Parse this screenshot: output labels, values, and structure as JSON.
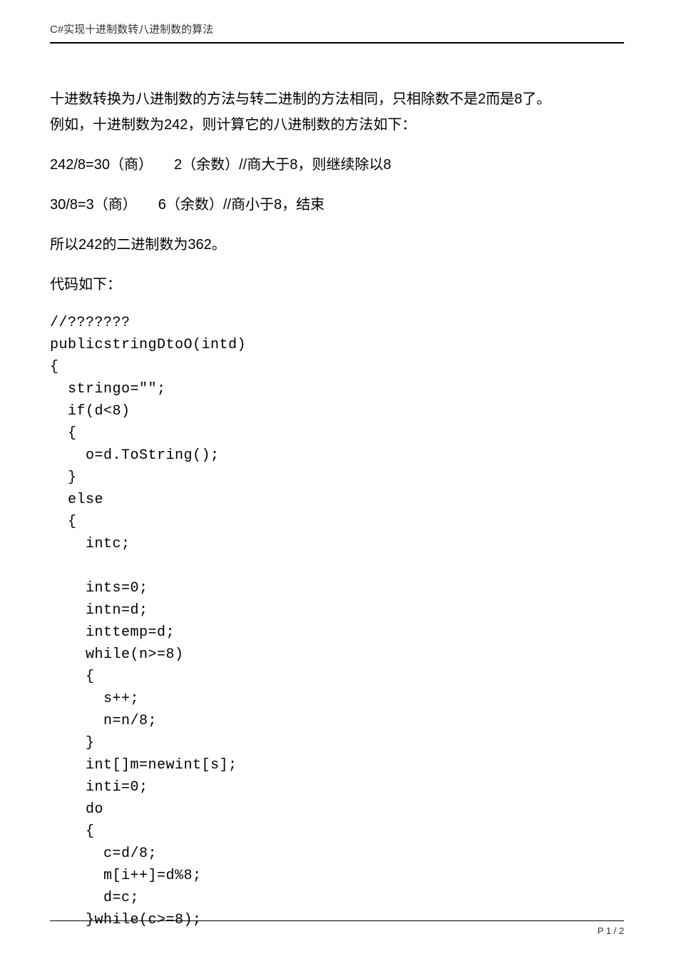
{
  "header": {
    "title": "C#实现十进制数转八进制数的算法"
  },
  "body": {
    "p1a": "十进数转换为八进制数的方法与转二进制的方法相同，只相除数不是2而是8了。",
    "p1b": "例如，十进制数为242，则计算它的八进制数的方法如下：",
    "p2": "242/8=30（商）　　2（余数）//商大于8，则继续除以8",
    "p3": "30/8=3（商）　　6（余数）//商小于8，结束",
    "p4": "所以242的二进制数为362。",
    "p5": "代码如下：",
    "code": "//???????\npublicstringDtoO(intd)\n{\n  stringo=\"\";\n  if(d<8)\n  {\n    o=d.ToString();\n  }\n  else\n  {\n    intc;\n\n    ints=0;\n    intn=d;\n    inttemp=d;\n    while(n>=8)\n    {\n      s++;\n      n=n/8;\n    }\n    int[]m=newint[s];\n    inti=0;\n    do\n    {\n      c=d/8;\n      m[i++]=d%8;\n      d=c;\n    }while(c>=8);"
  },
  "footer": {
    "page_label": "P 1 / 2"
  }
}
